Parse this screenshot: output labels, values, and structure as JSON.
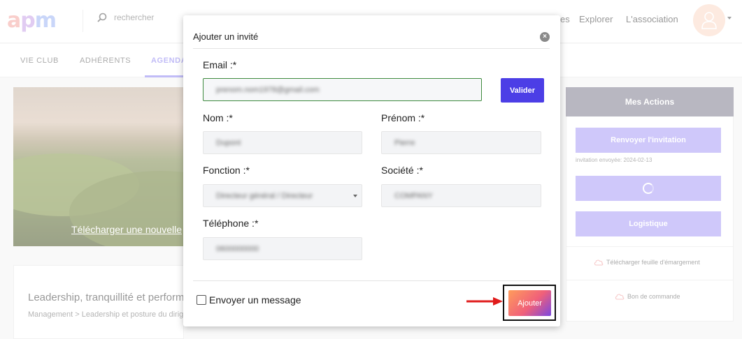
{
  "header": {
    "logo": [
      "a",
      "p",
      "m"
    ],
    "search_placeholder": "rechercher",
    "nav": [
      "es",
      "Explorer",
      "L'association"
    ]
  },
  "tabs": [
    "VIE CLUB",
    "ADHÉRENTS",
    "AGENDA"
  ],
  "hero": {
    "link": "Télécharger une nouvelle"
  },
  "event": {
    "title": "Leadership, tranquillité et performance",
    "breadcrumb": "Management > Leadership et posture du dirigeant"
  },
  "actions": {
    "title": "Mes Actions",
    "resend_label": "Renvoyer l'invitation",
    "invitation_note": "invitation envoyée: 2024-02-13",
    "logistics_label": "Logistique",
    "download_sheet": "Télécharger feuille d'émargement",
    "purchase_order": "Bon de commande"
  },
  "modal": {
    "title": "Ajouter un invité",
    "close": "×",
    "email_label": "Email :*",
    "email_value": "prenom.nom1978@gmail.com",
    "validate_label": "Valider",
    "nom_label": "Nom :*",
    "nom_value": "Dupont",
    "prenom_label": "Prénom :*",
    "prenom_value": "Pierre",
    "fonction_label": "Fonction :*",
    "fonction_value": "Directeur général / Directeur",
    "societe_label": "Société :*",
    "societe_value": "COMPANY",
    "telephone_label": "Téléphone :*",
    "telephone_value": "0600000000",
    "send_message_label": "Envoyer un message",
    "send_message_checked": false,
    "submit_label": "Ajouter"
  },
  "colors": {
    "accent": "#4c3ee6",
    "action_button": "#a89cf6",
    "annotation_arrow": "#e01b1b"
  }
}
